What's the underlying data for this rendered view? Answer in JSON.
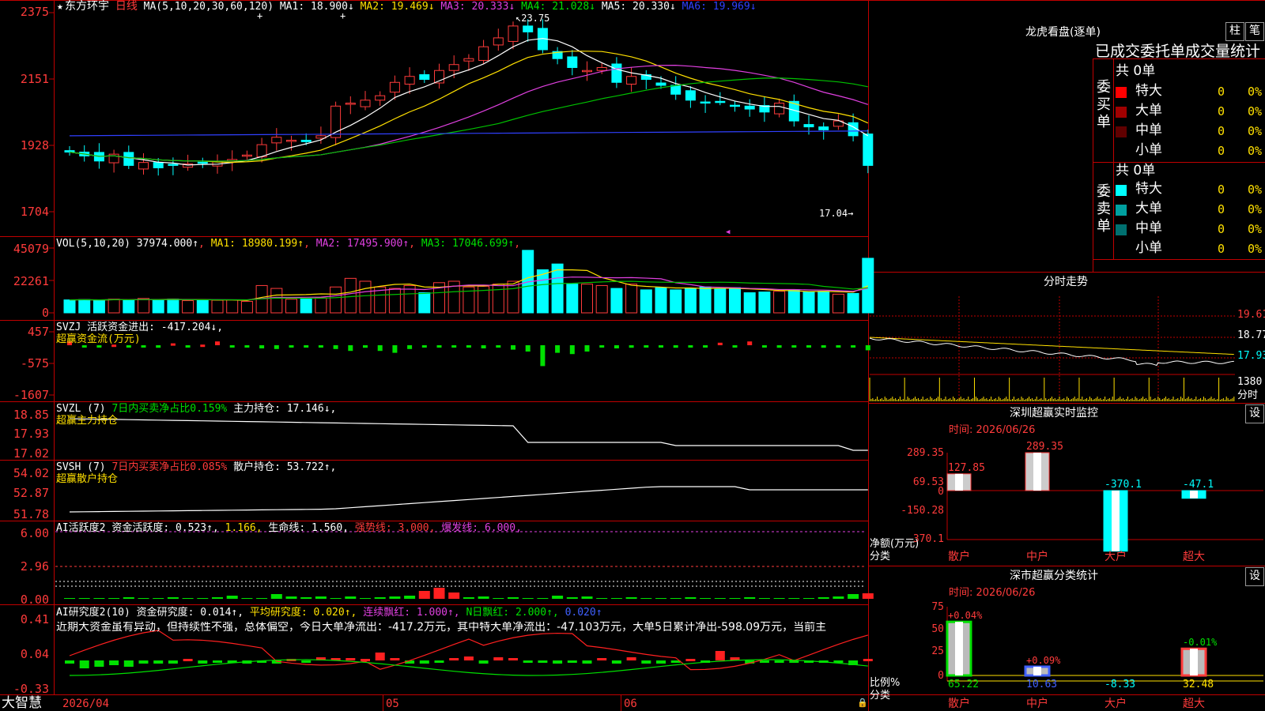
{
  "app": {
    "brand": "大智慧"
  },
  "stock": {
    "name": "东方环宇",
    "period": "日线"
  },
  "kline": {
    "ma_label": "MA(5,10,20,30,60,120)",
    "ma": [
      {
        "label": "MA1: 18.900↓",
        "color": "#ffffff"
      },
      {
        "label": "MA2: 19.469↓",
        "color": "#ffe000"
      },
      {
        "label": "MA3: 20.333↓",
        "color": "#e040e0"
      },
      {
        "label": "MA4: 21.028↓",
        "color": "#00e000"
      },
      {
        "label": "MA5: 20.330↓",
        "color": "#ffffff"
      },
      {
        "label": "MA6: 19.969↓",
        "color": "#3040ff"
      }
    ],
    "y_ticks": [
      "2375",
      "2151",
      "1928",
      "1704"
    ],
    "high_note": "23.75",
    "low_note": "17.04"
  },
  "vol": {
    "label": "VOL(5,10,20)",
    "value": "37974.000↑",
    "ma1": "MA1: 18980.199↑",
    "ma2": "MA2: 17495.900↑",
    "ma3": "MA3: 17046.699↑",
    "y_ticks": [
      "45079",
      "22261",
      "0"
    ]
  },
  "svzj": {
    "label": "SVZJ",
    "text": "活跃资金进出: -417.204↓,",
    "sub": "超赢资金流(万元)",
    "y_ticks": [
      "457",
      "-575",
      "-1607"
    ]
  },
  "svzl": {
    "label": "SVZL (7)",
    "ratio": "7日内买卖净占比0.159%",
    "hold": "主力持仓: 17.146↓,",
    "sub": "超赢主力持仓",
    "y_ticks": [
      "18.85",
      "17.93",
      "17.02"
    ]
  },
  "svsh": {
    "label": "SVSH (7)",
    "ratio": "7日内买卖净占比0.085%",
    "hold": "散户持仓: 53.722↑,",
    "sub": "超赢散户持仓",
    "y_ticks": [
      "54.02",
      "52.87",
      "51.78"
    ]
  },
  "ai1": {
    "label": "AI活跃度2",
    "a": "资金活跃度: 0.523↑,",
    "b": "1.166,",
    "c": "生命线: 1.560,",
    "d": "强势线: 3.000,",
    "e": "爆发线: 6.000,",
    "y_ticks": [
      "6.00",
      "2.96",
      "0.00"
    ]
  },
  "ai2": {
    "label": "AI研究度2(10)",
    "a": "资金研究度: 0.014↑,",
    "b": "平均研究度: 0.020↑,",
    "c": "连续飘红: 1.000↑,",
    "d": "N日飘红: 2.000↑,",
    "e": "0.020↑",
    "comment": "近期大资金虽有异动，但持续性不强，总体偏空，今日大单净流出：-417.2万元，其中特大单净流出：-47.103万元，大单5日累计净出-598.09万元，当前主",
    "y_ticks": [
      "0.41",
      "0.04",
      "-0.33"
    ]
  },
  "x_axis": {
    "labels": [
      "2026/04",
      "05",
      "06"
    ]
  },
  "right": {
    "dragon": {
      "title": "龙虎看盘(逐单)",
      "btn_zhu": "柱",
      "btn_bi": "笔",
      "header": "已成交委托单成交量统计",
      "buy": {
        "side": "委买单",
        "total": "共 0单",
        "rows": [
          {
            "name": "特大",
            "val": "0",
            "pct": "0%",
            "color": "#ff0000"
          },
          {
            "name": "大单",
            "val": "0",
            "pct": "0%",
            "color": "#a00000"
          },
          {
            "name": "中单",
            "val": "0",
            "pct": "0%",
            "color": "#600000"
          },
          {
            "name": "小单",
            "val": "0",
            "pct": "0%",
            "color": "#000000"
          }
        ]
      },
      "sell": {
        "side": "委卖单",
        "total": "共 0单",
        "rows": [
          {
            "name": "特大",
            "val": "0",
            "pct": "0%",
            "color": "#00ffff"
          },
          {
            "name": "大单",
            "val": "0",
            "pct": "0%",
            "color": "#00a0a0"
          },
          {
            "name": "中单",
            "val": "0",
            "pct": "0%",
            "color": "#007070"
          },
          {
            "name": "小单",
            "val": "0",
            "pct": "0%",
            "color": "#000000"
          }
        ]
      }
    },
    "minute": {
      "title": "分时走势",
      "prices": [
        "19.61",
        "18.77",
        "17.93"
      ],
      "vol": "1380",
      "vol_label": "分时"
    },
    "monitor": {
      "title": "深圳超赢实时监控",
      "btn": "设",
      "time": "时间: 2026/06/26",
      "y_ticks": [
        "289.35",
        "69.53",
        "0",
        "-150.28",
        "-370.1"
      ],
      "unit": "净额(万元)",
      "cat_label": "分类",
      "cats": [
        "散户",
        "中户",
        "大户",
        "超大"
      ],
      "values": [
        127.85,
        289.35,
        -370.1,
        -47.1
      ],
      "value_labels": [
        "127.85",
        "289.35",
        "-370.1",
        "-47.1"
      ]
    },
    "classify": {
      "title": "深市超赢分类统计",
      "btn": "设",
      "time": "时间: 2026/06/26",
      "y_ticks": [
        "75",
        "50",
        "25",
        "0"
      ],
      "ratio_label": "比例%",
      "cat_label": "分类",
      "cats": [
        "散户",
        "中户",
        "大户",
        "超大"
      ],
      "values": [
        65.22,
        10.63,
        -8.33,
        32.48
      ],
      "value_labels": [
        "65.22",
        "10.63",
        "-8.33",
        "32.48"
      ],
      "changes": [
        "+0.04%",
        "+0.09%",
        "",
        "-0.01%"
      ]
    }
  },
  "chart_data": [
    {
      "type": "candlestick",
      "title": "东方环宇 日线",
      "ylim": [
        17.04,
        23.75
      ],
      "series": [
        {
          "name": "close",
          "values": [
            19.05,
            18.92,
            18.75,
            18.98,
            18.6,
            18.7,
            18.52,
            18.6,
            18.65,
            18.7,
            18.74,
            18.8,
            18.95,
            19.3,
            19.55,
            19.45,
            19.4,
            19.6,
            20.6,
            20.7,
            20.8,
            20.95,
            21.4,
            21.6,
            21.5,
            21.8,
            22.0,
            22.2,
            22.6,
            22.9,
            23.3,
            23.1,
            22.5,
            22.2,
            21.9,
            21.8,
            21.9,
            21.4,
            21.6,
            21.5,
            21.3,
            21.0,
            20.8,
            20.7,
            20.75,
            20.6,
            20.5,
            20.4,
            20.7,
            20.1,
            19.9,
            19.8,
            20.1,
            19.6,
            18.6
          ]
        }
      ]
    },
    {
      "type": "bar",
      "title": "VOL(5,10,20)",
      "ylim": [
        0,
        45079
      ],
      "values": [
        9000,
        9200,
        8800,
        9500,
        9000,
        10000,
        9000,
        9500,
        8500,
        9000,
        8800,
        9000,
        8000,
        19000,
        17000,
        9500,
        10000,
        10500,
        18000,
        24000,
        22000,
        18000,
        17000,
        19000,
        14000,
        21000,
        22000,
        18000,
        18500,
        20000,
        22000,
        43500,
        30000,
        34000,
        20000,
        20000,
        19000,
        17000,
        20000,
        16000,
        17500,
        16000,
        17000,
        18000,
        17000,
        17500,
        14000,
        14500,
        15000,
        16000,
        14500,
        15000,
        13000,
        13500,
        37974
      ]
    }
  ]
}
